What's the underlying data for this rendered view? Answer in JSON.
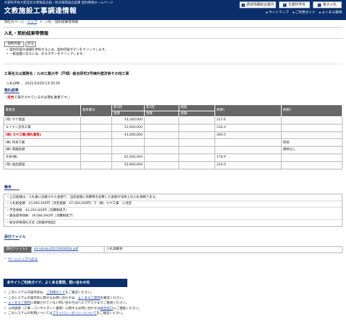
{
  "header": {
    "subtitle": "文部科学省大臣官房文教施設企画・防災部施設企画課 契約情報ホームページ",
    "title": "文教施設工事調達情報",
    "buttons": [
      "調達情報総合案内",
      "文部科学省",
      "電子入札"
    ],
    "links": [
      "サイトマップ",
      "ご利用ガイド",
      "よくある質問"
    ]
  },
  "breadcrumb": {
    "prefix": "現在のページ :",
    "top": "トップ",
    "sep": ">",
    "current": "入札・契約結果等情報"
  },
  "page_title": "入札・契約結果等情報",
  "buttons": {
    "detail": "契約内容",
    "back": "戻る"
  },
  "notes": [
    "契約内容の詳細を参照するには、契約内容ボタンをクリックします。",
    "一覧画面に戻るには、戻るボタンをクリックします。"
  ],
  "project_title": "工事名又は業務名 : 九州工業大学（戸畑）総合研究3号棟外壁改修その他工事",
  "bid_date": "入札日時 :　2021/10/29 13:30:00",
  "section_result": "落札結果",
  "legend": {
    "open": "（",
    "red": "赤色",
    "rest": "で表示されているのは落札業者です。）"
  },
  "table": {
    "headers": [
      "業者名",
      "業者番号",
      "第1回",
      "第2回",
      "随契",
      "摘要1",
      "摘要2"
    ],
    "subheaders": [
      "金額",
      "金額",
      "金額"
    ],
    "rows": [
      {
        "name": "(有) ヤナ建設",
        "no": "",
        "r1": "53,300,000",
        "r2": "",
        "zui": "",
        "t1": "217.6",
        "t2": "",
        "winner": false
      },
      {
        "name": "エイケン塗装工業",
        "no": "",
        "r1": "51,600,000",
        "r2": "",
        "zui": "",
        "t1": "236.4",
        "t2": "",
        "winner": false
      },
      {
        "name": "(株) カヤ工業(落札業者)",
        "no": "",
        "r1": "43,000,000",
        "r2": "",
        "zui": "",
        "t1": "260.5",
        "t2": "",
        "winner": true
      },
      {
        "name": "(株) 和泉工業",
        "no": "",
        "r1": "",
        "r2": "",
        "zui": "",
        "t1": "",
        "t2": "辞退",
        "winner": false
      },
      {
        "name": "(株) 南龍住建",
        "no": "",
        "r1": "",
        "r2": "",
        "zui": "",
        "t1": "",
        "t2": "資格なし",
        "winner": false
      },
      {
        "name": "大栄(株)",
        "no": "",
        "r1": "61,500,000",
        "r2": "",
        "zui": "",
        "t1": "178.9",
        "t2": "",
        "winner": false
      },
      {
        "name": "(有) 福出建設",
        "no": "",
        "r1": "52,800,000",
        "r2": "",
        "zui": "",
        "t1": "214.0",
        "t2": "",
        "winner": false
      }
    ]
  },
  "section_remarks": "備考",
  "remarks": [
    "・上記金額は、入札書に記載された金額で、当該金額に消費税を加算した金額が法律上の入札価格である。",
    "・入札総金額　43,000,000円（決定金額　47,300,000円）で（株）カヤ工業　に決定",
    "・予定価格　43,350,000円（消費税抜き）",
    "・最低基準価格　39,084,892円（消費税抜き）",
    "・総合評価落札方式【実績評価型】"
  ],
  "section_attach": "添付ファイル",
  "attachment": {
    "label": "添付ファイル1",
    "file": "shi-kikaku2021092902b.pdf",
    "desc": "入札調書他"
  },
  "pagetop": "ページトップへ戻る",
  "footer": {
    "banner": "本サイトご利用ガイド、よくある質問、問い合わせ先",
    "items": [
      {
        "pre": "このシステムの操作等は、",
        "link": "ご利用ガイド",
        "post": "をご確認ください。"
      },
      {
        "pre": "このシステムの操作等に関するお問い合わせは、",
        "link": "よくあるご質問",
        "post": "を確認ください。"
      },
      {
        "pre": "",
        "link": "よくあるご質問",
        "post": "に掲載されていない問い合わせはヘルプデスクまでご連絡ください。"
      },
      {
        "pre": "公共調達（工事・コンサルタント業務）に関するお問い合わせは",
        "link": "総合窓口",
        "post": "にご連絡ください。"
      },
      {
        "pre": "このシステムの利用については",
        "link": "プライバシーポリシーについて",
        "post": "をご確認ください。"
      }
    ]
  }
}
